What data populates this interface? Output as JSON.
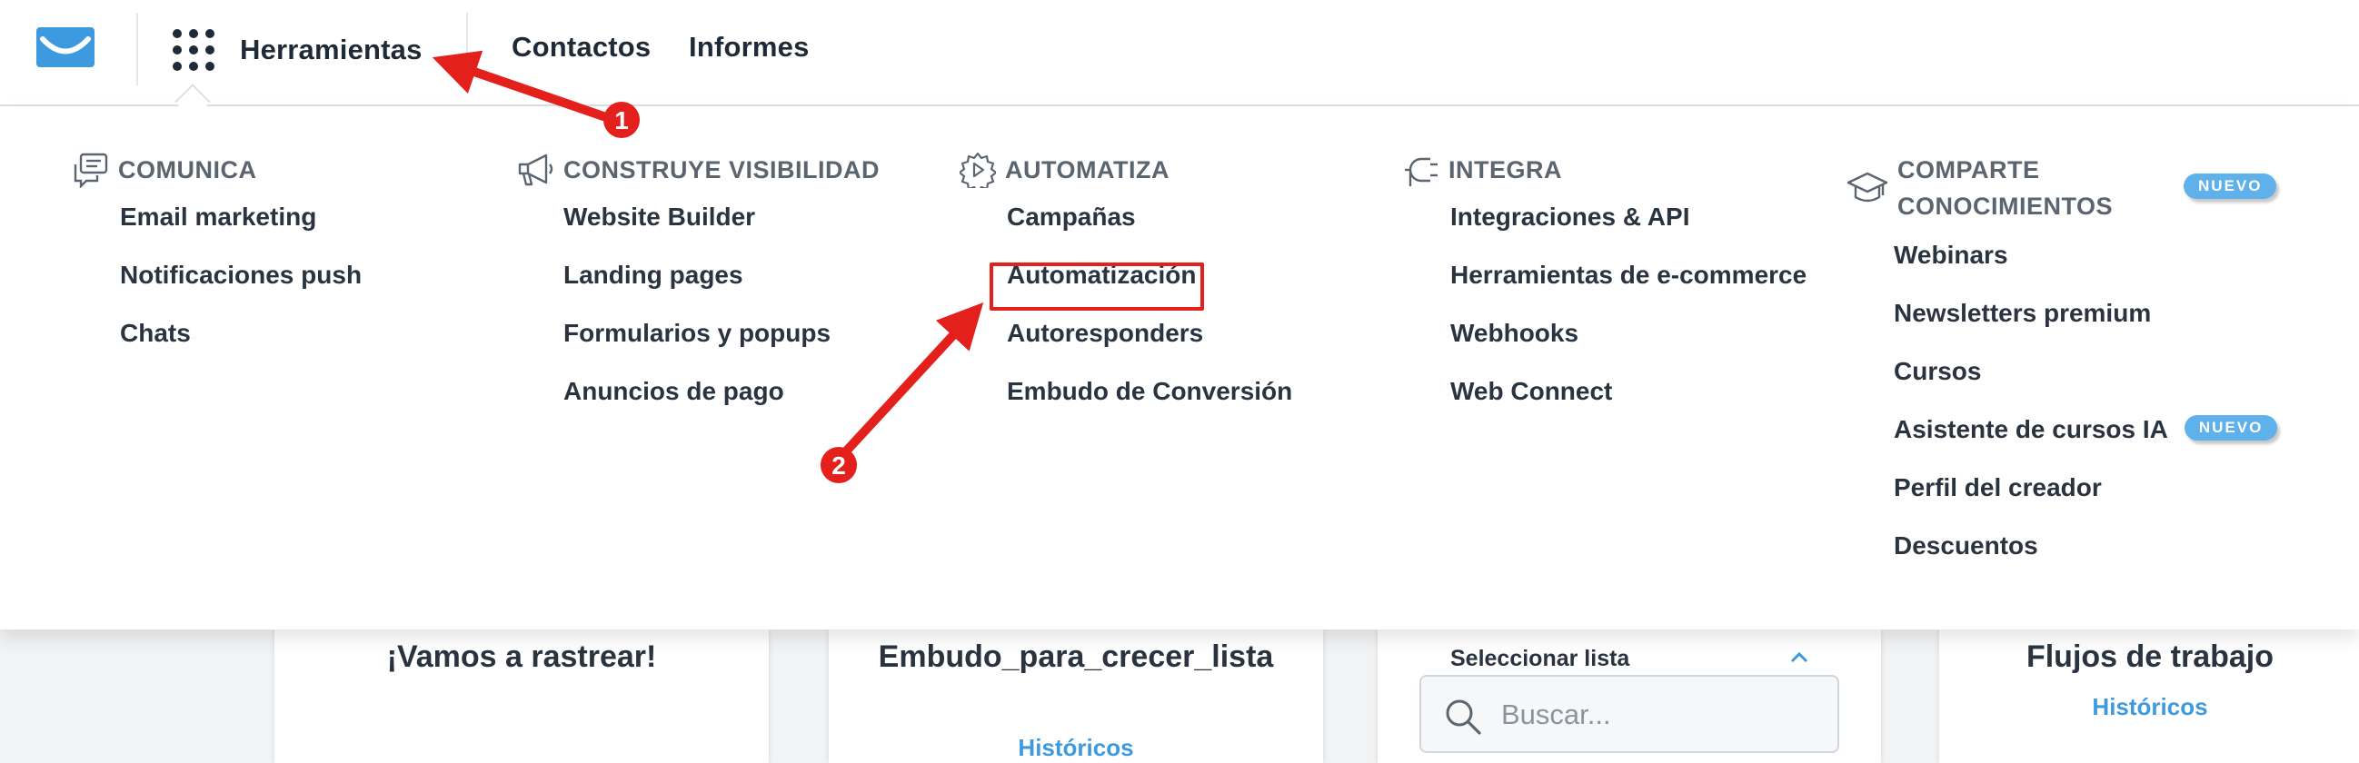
{
  "nav": {
    "tools_label": "Herramientas",
    "contacts_label": "Contactos",
    "reports_label": "Informes"
  },
  "menu": {
    "columns": [
      {
        "title": "COMUNICA",
        "icon": "chat-bubbles-icon",
        "items": [
          "Email marketing",
          "Notificaciones push",
          "Chats"
        ]
      },
      {
        "title": "CONSTRUYE VISIBILIDAD",
        "icon": "megaphone-icon",
        "items": [
          "Website Builder",
          "Landing pages",
          "Formularios y popups",
          "Anuncios de pago"
        ]
      },
      {
        "title": "AUTOMATIZA",
        "icon": "gear-play-icon",
        "items": [
          "Campañas",
          "Automatización",
          "Autoresponders",
          "Embudo de Conversión"
        ]
      },
      {
        "title": "INTEGRA",
        "icon": "plug-icon",
        "items": [
          "Integraciones & API",
          "Herramientas de e-commerce",
          "Webhooks",
          "Web Connect"
        ]
      },
      {
        "title_line1": "COMPARTE",
        "title_line2": "CONOCIMIENTOS",
        "icon": "graduation-cap-icon",
        "badge": "NUEVO",
        "items": [
          "Webinars",
          "Newsletters premium",
          "Cursos",
          "Asistente de cursos IA",
          "Perfil del creador",
          "Descuentos"
        ],
        "item_badge": "NUEVO"
      }
    ]
  },
  "page": {
    "card1_title": "¡Vamos a rastrear!",
    "card2_title": "Embudo_para_crecer_lista",
    "card2_link": "Históricos",
    "select_label": "Seleccionar lista",
    "search_placeholder": "Buscar...",
    "card4_title": "Flujos de trabajo",
    "card4_link": "Históricos"
  },
  "annotations": {
    "step1": "1",
    "step2": "2"
  },
  "colors": {
    "accent": "#3d9ade",
    "badge": "#5eb1ea",
    "annotation": "#e3201b",
    "text": "#1f2a37"
  }
}
